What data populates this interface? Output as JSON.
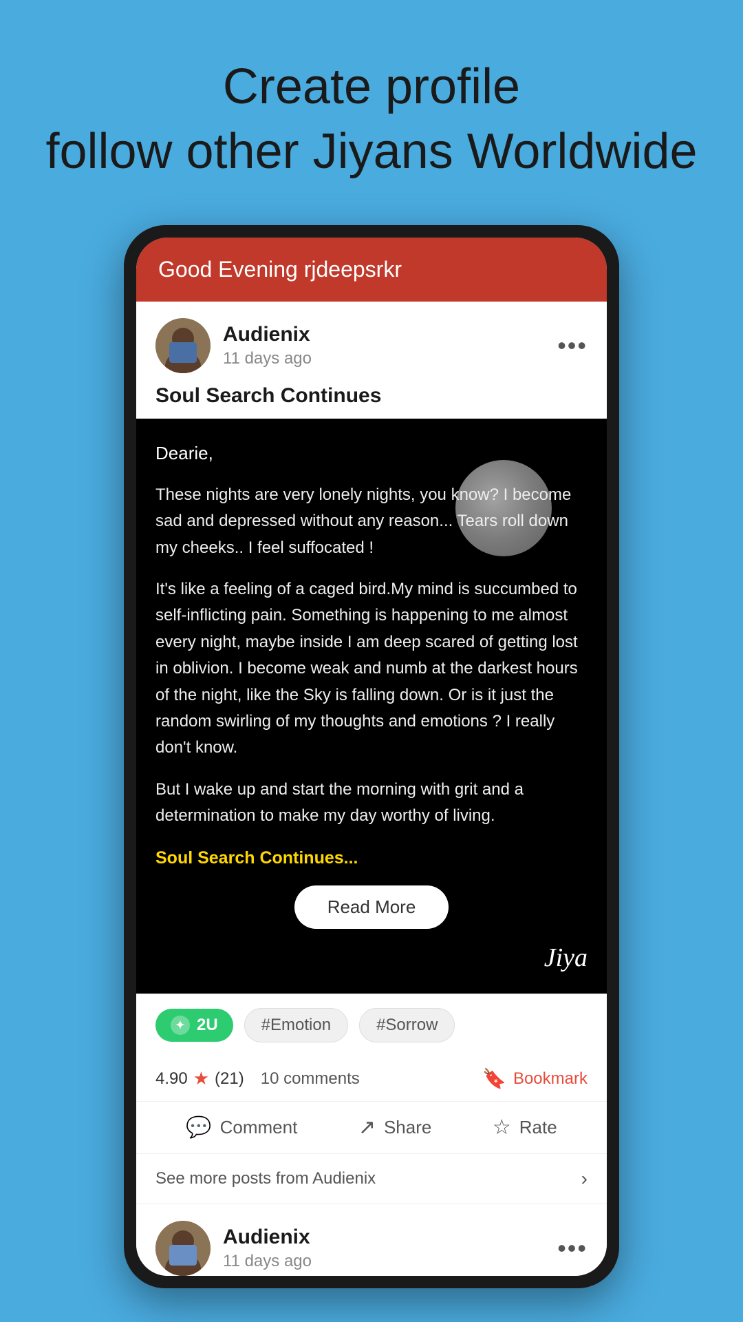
{
  "hero": {
    "line1": "Create profile",
    "line2": "follow other Jiyans Worldwide"
  },
  "app": {
    "header_greeting": "Good Evening rjdeepsrkr"
  },
  "post": {
    "author": "Audienix",
    "time_ago": "11 days ago",
    "title": "Soul Search Continues",
    "greeting_line": "Dearie,",
    "paragraph1": "These nights are very lonely nights, you know? I become sad and depressed without any reason... Tears roll down my cheeks.. I feel suffocated !",
    "paragraph2": "It's like a feeling of a caged bird.My mind is succumbed to self-inflicting pain. Something is happening to me almost every night, maybe inside  I am deep scared of  getting lost in oblivion. I become weak and numb at the darkest hours of the night, like the  Sky is falling down. Or is it just the random swirling of  my thoughts and emotions ? I really don't know.",
    "paragraph3": "But I wake up and start the morning with grit and a determination to make my day worthy of living.",
    "highlight_text": "Soul Search Continues...",
    "signature": "Jiya",
    "read_more_label": "Read More",
    "tag_2u": "2U",
    "tag_emotion": "#Emotion",
    "tag_sorrow": "#Sorrow",
    "rating": "4.90",
    "rating_count": "(21)",
    "comments": "10 comments",
    "bookmark_label": "Bookmark",
    "comment_label": "Comment",
    "share_label": "Share",
    "rate_label": "Rate",
    "see_more": "See more posts from Audienix",
    "more_dots": "•••"
  },
  "second_post": {
    "author": "Audienix",
    "time_ago": "11 days ago",
    "more_dots": "•••"
  },
  "icons": {
    "more": "•••",
    "arrow_right": "›",
    "star": "★",
    "bookmark": "🔖",
    "comment": "💬",
    "share": "↗",
    "rate": "☆"
  },
  "colors": {
    "background": "#4AABDF",
    "header_red": "#C0392B",
    "highlight_yellow": "#FFD700",
    "tag_green": "#2ecc71",
    "accent_red": "#e74c3c"
  }
}
